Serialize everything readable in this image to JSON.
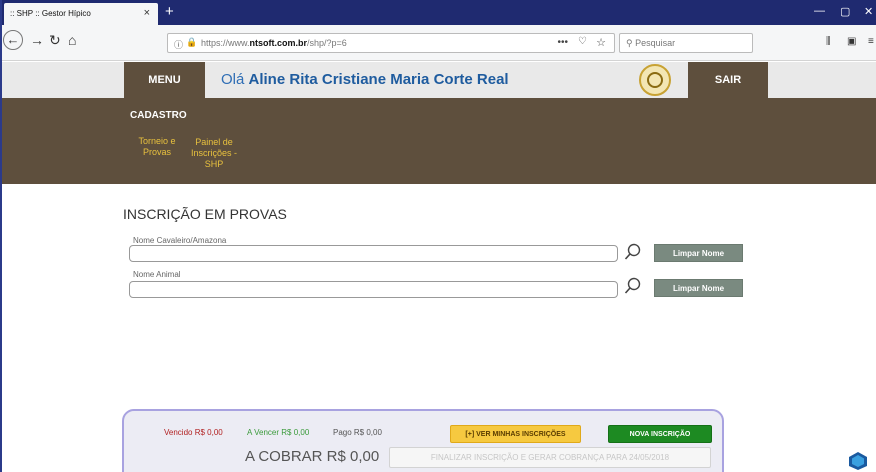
{
  "browser": {
    "tab_title": ":: SHP :: Gestor Hípico",
    "tab_close": "×",
    "new_tab": "+",
    "url_prefix": "https://www.",
    "url_domain": "ntsoft.com.br",
    "url_path": "/shp/?p=6",
    "search_placeholder": "Pesquisar",
    "url_dots": "•••"
  },
  "header": {
    "menu_label": "MENU",
    "greeting_prefix": "Olá",
    "user_name": "Aline Rita Cristiane Maria Corte Real",
    "logout_label": "SAIR"
  },
  "menu": {
    "section": "CADASTRO",
    "items": [
      {
        "label_line1": "Torneio e",
        "label_line2": "Provas",
        "label_line3": ""
      },
      {
        "label_line1": "Painel de",
        "label_line2": "Inscrições -",
        "label_line3": "SHP"
      }
    ]
  },
  "form": {
    "title": "INSCRIÇÃO EM PROVAS",
    "rider_label": "Nome Cavaleiro/Amazona",
    "rider_value": "",
    "animal_label": "Nome Animal",
    "animal_value": "",
    "clear_button": "Limpar Nome"
  },
  "summary": {
    "vencido": "Vencido R$ 0,00",
    "a_vencer": "A Vencer R$ 0,00",
    "pago": "Pago R$ 0,00",
    "ver_button": "[+] VER MINHAS INSCRIÇÕES",
    "nova_button": "NOVA INSCRIÇÃO",
    "a_cobrar": "A COBRAR R$ 0,00",
    "finalizar_button": "FINALIZAR INSCRIÇÃO E GERAR COBRANÇA PARA 24/05/2018"
  },
  "colors": {
    "brown": "#5e4f3d",
    "gold_text": "#e8c13e",
    "link_blue": "#2f6eb5",
    "vencido": "#b22222",
    "a_vencer": "#3a9a3a",
    "pago": "#555555"
  },
  "icons": {
    "back": "back-arrow-icon",
    "forward": "forward-arrow-icon",
    "reload": "reload-icon",
    "home": "home-icon",
    "search": "magnifier-icon"
  }
}
